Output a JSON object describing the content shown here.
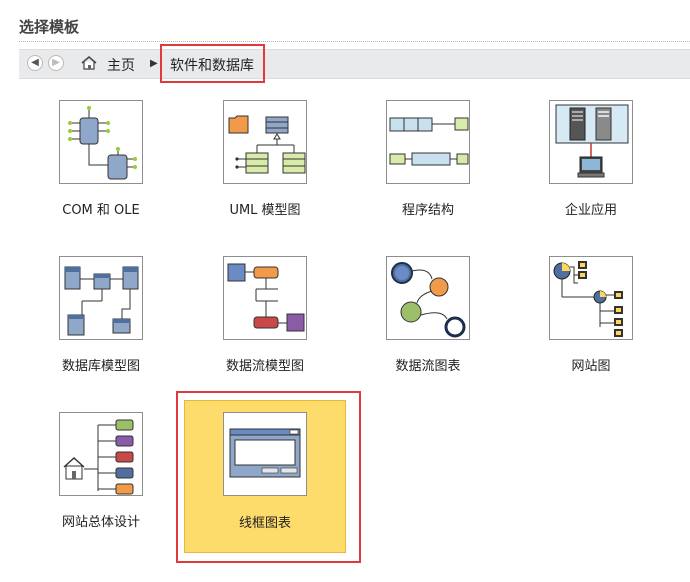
{
  "header": {
    "title": "选择模板"
  },
  "nav": {
    "back_glyph": "◀",
    "forward_glyph": "▶",
    "home_label": "主页",
    "separator": "▶",
    "current": "软件和数据库"
  },
  "templates": [
    {
      "label": "COM 和 OLE",
      "icon": "com-ole-icon",
      "selected": false
    },
    {
      "label": "UML 模型图",
      "icon": "uml-model-icon",
      "selected": false
    },
    {
      "label": "程序结构",
      "icon": "program-structure-icon",
      "selected": false
    },
    {
      "label": "企业应用",
      "icon": "enterprise-app-icon",
      "selected": false
    },
    {
      "label": "数据库模型图",
      "icon": "database-model-icon",
      "selected": false
    },
    {
      "label": "数据流模型图",
      "icon": "data-flow-model-icon",
      "selected": false
    },
    {
      "label": "数据流图表",
      "icon": "data-flow-chart-icon",
      "selected": false
    },
    {
      "label": "网站图",
      "icon": "website-map-icon",
      "selected": false
    },
    {
      "label": "网站总体设计",
      "icon": "website-master-plan-icon",
      "selected": false
    },
    {
      "label": "线框图表",
      "icon": "wireframe-chart-icon",
      "selected": true
    }
  ],
  "colors": {
    "selection_fill": "#fedc6b",
    "highlight_border": "#e0393e"
  }
}
